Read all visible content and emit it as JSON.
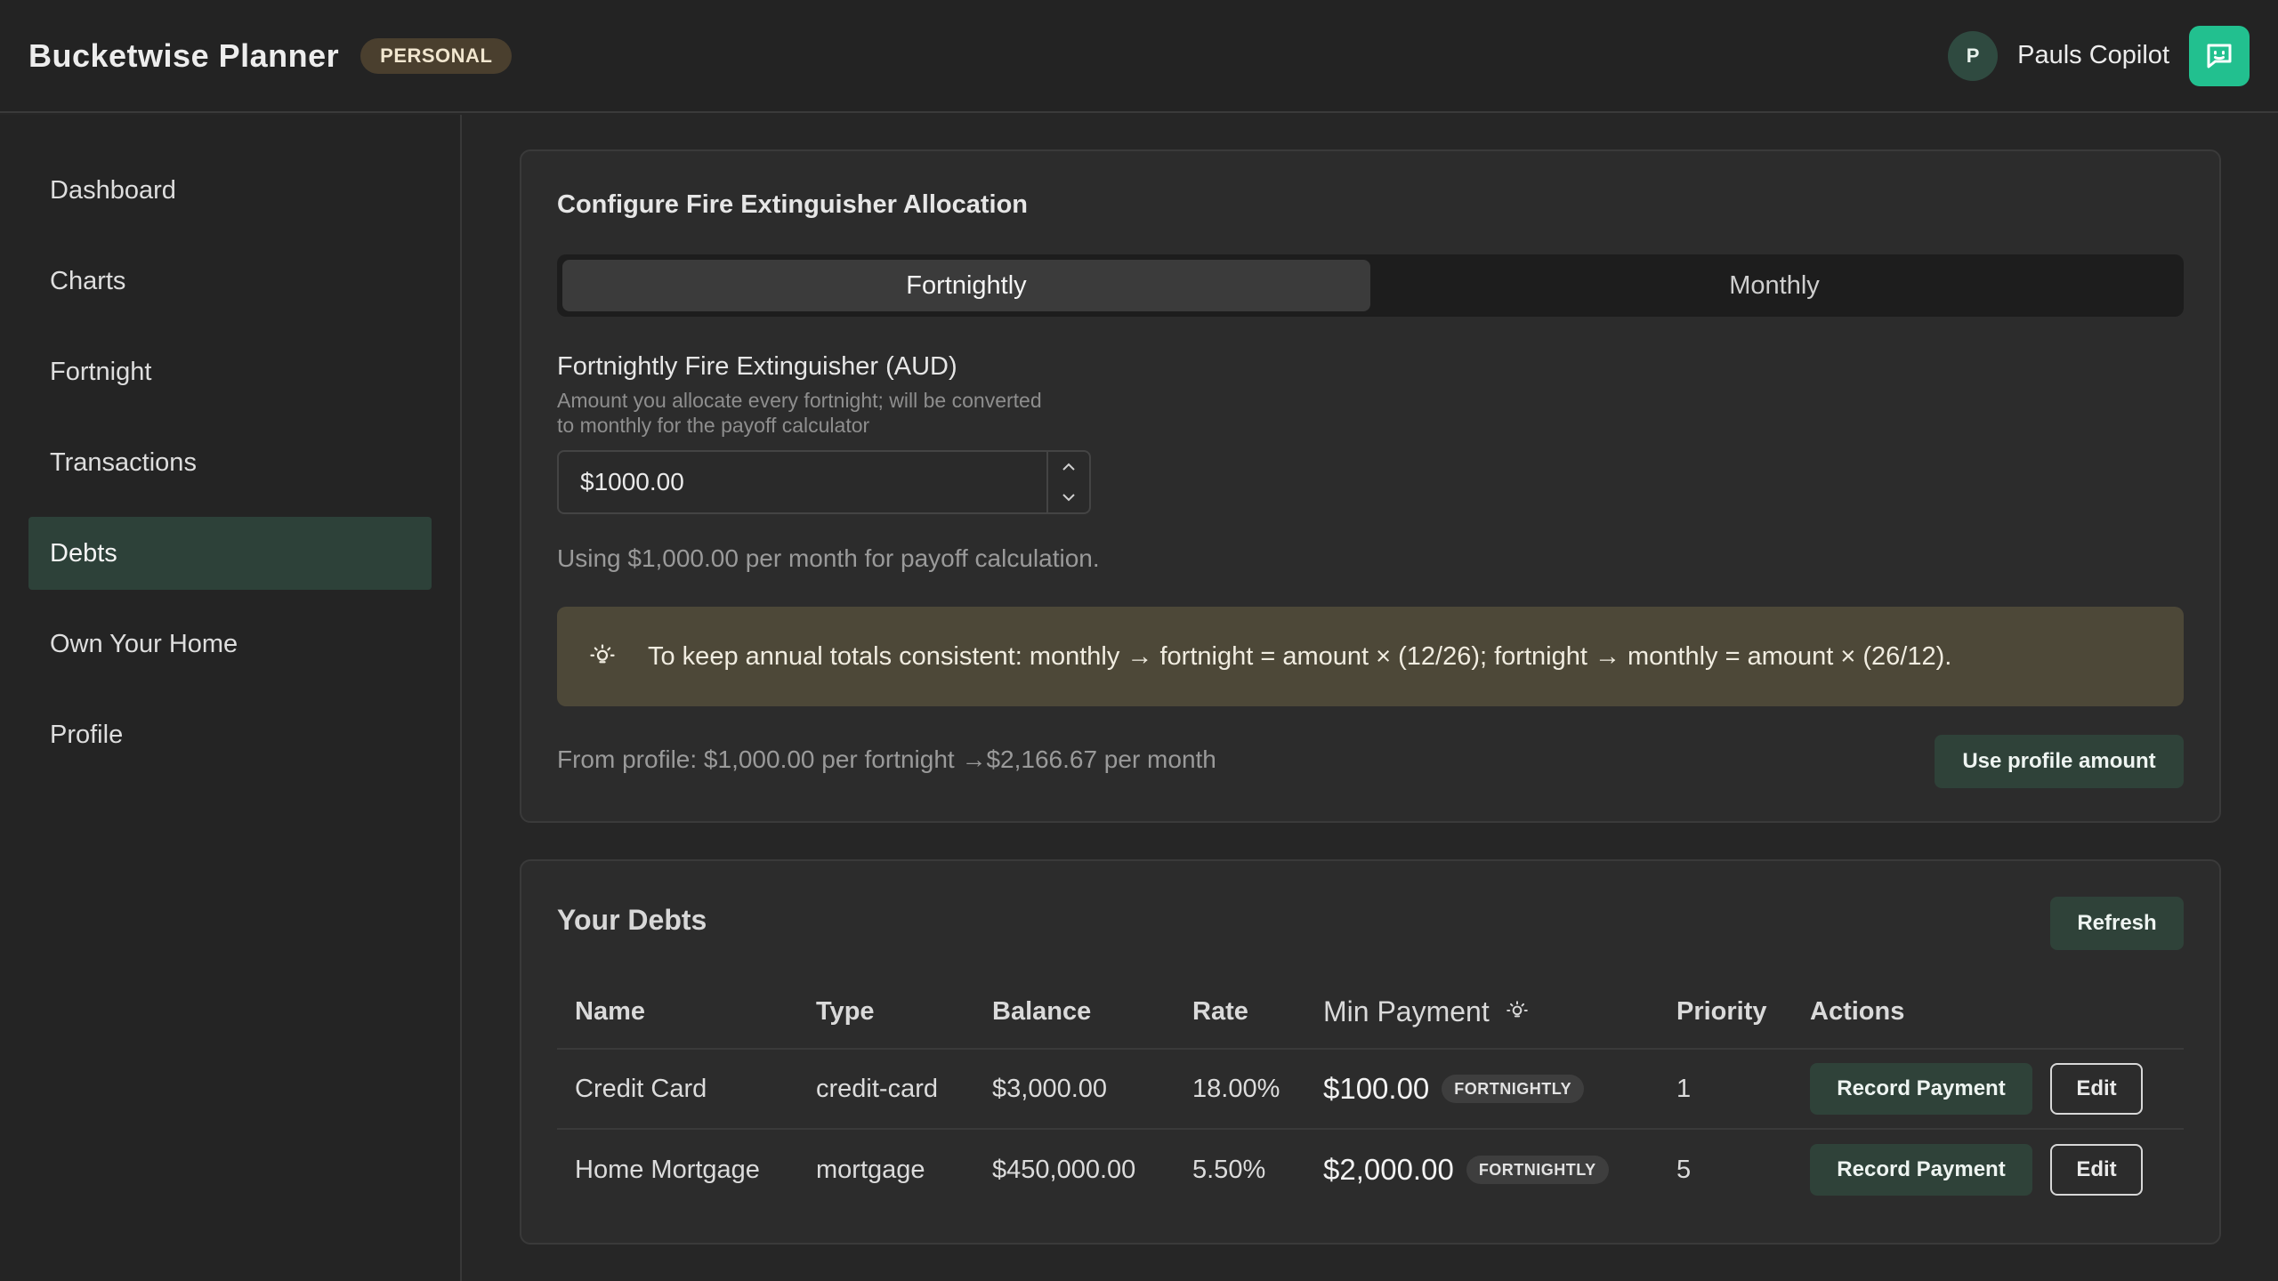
{
  "header": {
    "brand": "Bucketwise Planner",
    "badge": "PERSONAL",
    "avatar_initial": "P",
    "user_name": "Pauls Copilot",
    "chat_icon": "chat-bubble-icon"
  },
  "sidebar": {
    "items": [
      {
        "label": "Dashboard",
        "active": false
      },
      {
        "label": "Charts",
        "active": false
      },
      {
        "label": "Fortnight",
        "active": false
      },
      {
        "label": "Transactions",
        "active": false
      },
      {
        "label": "Debts",
        "active": true
      },
      {
        "label": "Own Your Home",
        "active": false
      },
      {
        "label": "Profile",
        "active": false
      }
    ]
  },
  "allocation": {
    "title": "Configure Fire Extinguisher Allocation",
    "tabs": [
      {
        "label": "Fortnightly",
        "active": true
      },
      {
        "label": "Monthly",
        "active": false
      }
    ],
    "field_label": "Fortnightly Fire Extinguisher (AUD)",
    "field_help": "Amount you allocate every fortnight; will be converted to monthly for the payoff calculator",
    "field_value": "$1000.00",
    "using_text": "Using $1,000.00 per month for payoff calculation.",
    "tip_icon": "lightbulb-icon",
    "tip_text": "To keep annual totals consistent: monthly → fortnight = amount × (12/26); fortnight → monthly = amount × (26/12).",
    "profile_text": "From profile: $1,000.00 per fortnight →$2,166.67 per month",
    "use_profile_label": "Use profile amount"
  },
  "debts": {
    "title": "Your Debts",
    "refresh_label": "Refresh",
    "columns": [
      "Name",
      "Type",
      "Balance",
      "Rate",
      "Min Payment",
      "Priority",
      "Actions"
    ],
    "rows": [
      {
        "name": "Credit Card",
        "type": "credit-card",
        "balance": "$3,000.00",
        "rate": "18.00%",
        "min_payment": "$100.00",
        "frequency": "FORTNIGHTLY",
        "priority": "1",
        "record_label": "Record Payment",
        "edit_label": "Edit"
      },
      {
        "name": "Home Mortgage",
        "type": "mortgage",
        "balance": "$450,000.00",
        "rate": "5.50%",
        "min_payment": "$2,000.00",
        "frequency": "FORTNIGHTLY",
        "priority": "5",
        "record_label": "Record Payment",
        "edit_label": "Edit"
      }
    ]
  },
  "colors": {
    "accent": "#22c08f",
    "active_nav": "#2d4139",
    "tip_bg": "#4d4838",
    "badge_bg": "#4a3f2e"
  }
}
